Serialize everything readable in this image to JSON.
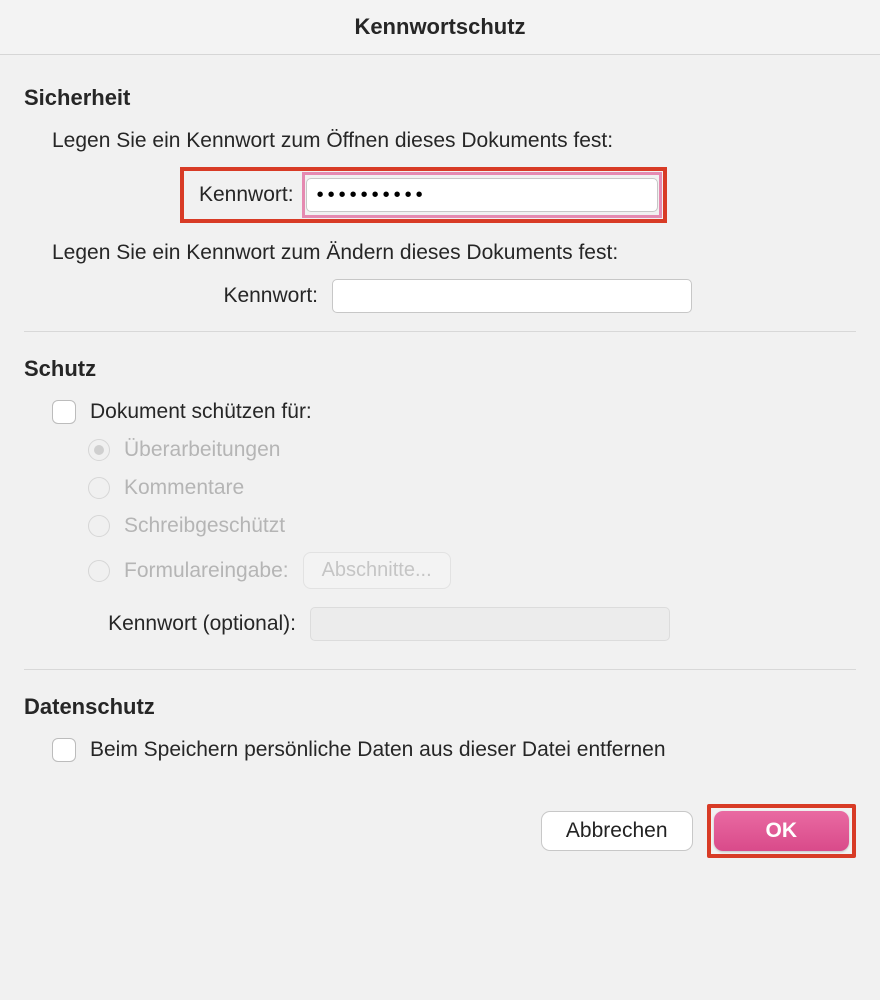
{
  "dialog": {
    "title": "Kennwortschutz"
  },
  "security": {
    "heading": "Sicherheit",
    "open_desc": "Legen Sie ein Kennwort zum Öffnen dieses Dokuments fest:",
    "open_label": "Kennwort:",
    "open_value": "••••••••••",
    "modify_desc": "Legen Sie ein Kennwort zum Ändern dieses Dokuments fest:",
    "modify_label": "Kennwort:",
    "modify_value": ""
  },
  "protection": {
    "heading": "Schutz",
    "protect_for": "Dokument schützen für:",
    "radio_revisions": "Überarbeitungen",
    "radio_comments": "Kommentare",
    "radio_readonly": "Schreibgeschützt",
    "radio_forms": "Formulareingabe:",
    "sections_button": "Abschnitte...",
    "optional_label": "Kennwort (optional):",
    "optional_value": ""
  },
  "privacy": {
    "heading": "Datenschutz",
    "remove_personal": "Beim Speichern persönliche Daten aus dieser Datei entfernen"
  },
  "buttons": {
    "cancel": "Abbrechen",
    "ok": "OK"
  }
}
